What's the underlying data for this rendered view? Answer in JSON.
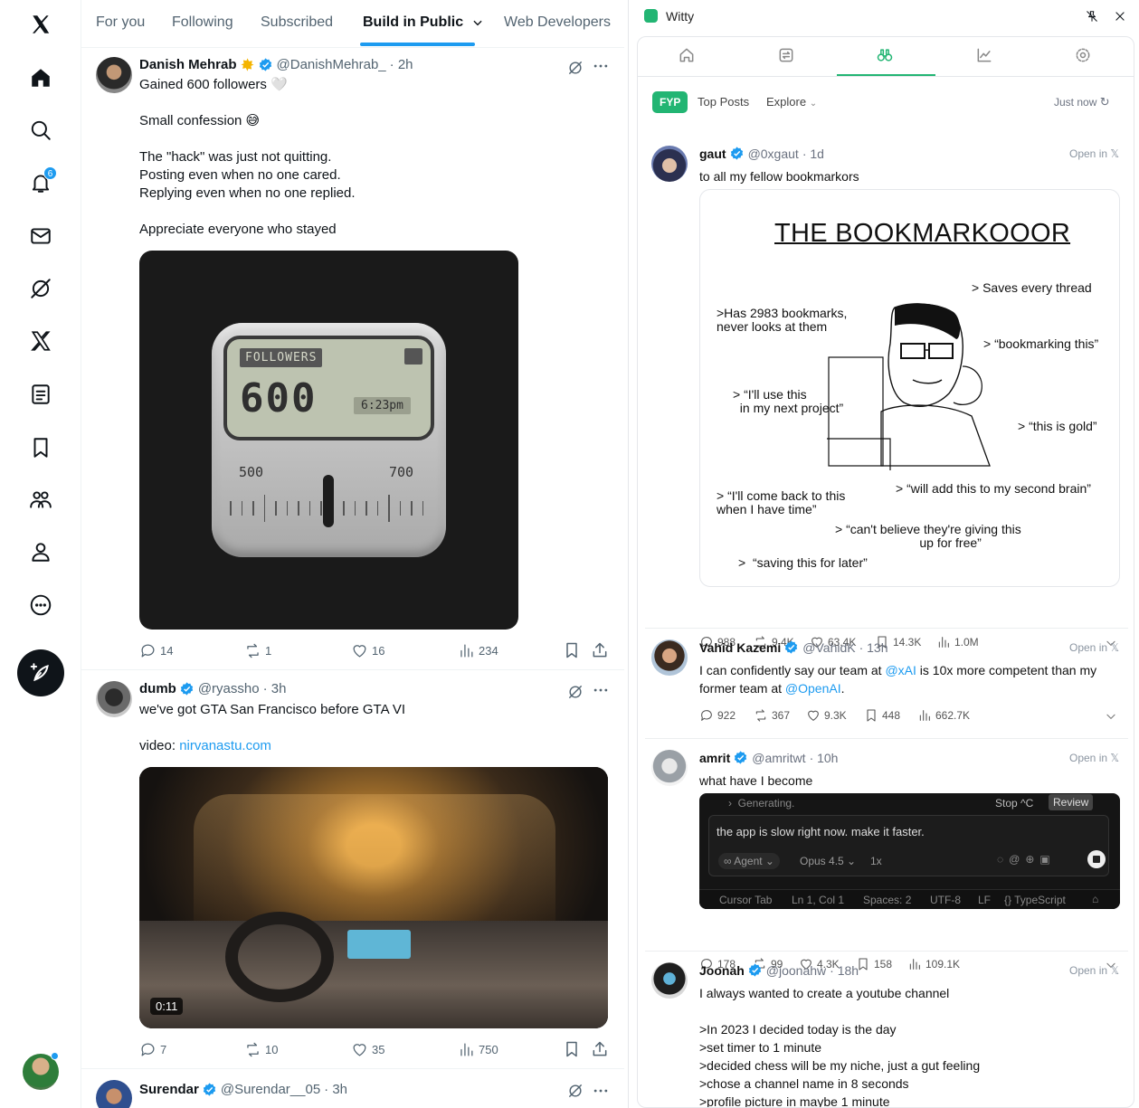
{
  "x_nav": {
    "notifications_badge": "6",
    "items": [
      "x-logo-icon",
      "home-icon",
      "search-icon",
      "bell-icon",
      "mail-icon",
      "grok-icon",
      "x-premium-icon",
      "lists-icon",
      "bookmark-icon",
      "communities-icon",
      "profile-icon",
      "more-circle-icon"
    ]
  },
  "feed": {
    "tabs": [
      "For you",
      "Following",
      "Subscribed",
      "Build in Public",
      "Web Developers"
    ],
    "posts": [
      {
        "name": "Danish Mehrab",
        "handle": "@DanishMehrab_",
        "time": "· 2h",
        "text": "Gained 600 followers 🤍\n\nSmall confession 😅\n\nThe \"hack\" was just not quitting.\nPosting even when no one cared.\nReplying even when no one replied.\n\nAppreciate everyone who stayed",
        "image": {
          "label": "FOLLOWERS",
          "value": "600",
          "time": "6:23pm",
          "scale_left": "500",
          "scale_right": "700"
        },
        "replies": "14",
        "reposts": "1",
        "likes": "16",
        "views": "234"
      },
      {
        "name": "dumb",
        "handle": "@ryassho",
        "time": "· 3h",
        "text_line1": "we've got GTA San Francisco before GTA VI",
        "text_video_label": "video: ",
        "text_link": "nirvanastu.com",
        "video_duration": "0:11",
        "replies": "7",
        "reposts": "10",
        "likes": "35",
        "views": "750"
      },
      {
        "name": "Surendar",
        "handle": "@Surendar__05",
        "time": "· 3h"
      }
    ]
  },
  "witty": {
    "title": "Witty",
    "tabs": [
      "home-icon",
      "repost-icon",
      "binoculars-icon",
      "chart-icon",
      "settings-icon"
    ],
    "filters": {
      "fyp": "FYP",
      "top": "Top Posts",
      "explore": "Explore"
    },
    "refresh": "Just now",
    "open_in": "Open in 𝕏",
    "posts": [
      {
        "name": "gaut",
        "handle": "@0xgaut",
        "time": "· 1d",
        "text": "to all my fellow bookmarkors",
        "meme": {
          "title": "THE BOOKMARKOOOR",
          "labels": [
            "> Saves every thread",
            ">Has 2983 bookmarks,\nnever looks at them",
            "> “bookmarking this”",
            "> “I'll use this\n  in my next project”",
            "> “this is gold”",
            "> “will add this to my second brain”",
            "> “I'll come back to this\nwhen I have time”",
            "> “can't believe they're giving this\n                        up for free”",
            ">  “saving this for later”"
          ]
        },
        "replies": "988",
        "reposts": "9.4K",
        "likes": "63.4K",
        "bookmarks": "14.3K",
        "views": "1.0M"
      },
      {
        "name": "Vahid Kazemi",
        "handle": "@VahidK",
        "time": "· 13h",
        "text_a": "I can confidently say our team at ",
        "mention_a": "@xAI",
        "text_b": " is 10x more competent than my",
        "text_c": "former team at ",
        "mention_b": "@OpenAI",
        "text_d": ".",
        "replies": "922",
        "reposts": "367",
        "likes": "9.3K",
        "bookmarks": "448",
        "views": "662.7K"
      },
      {
        "name": "amrit",
        "handle": "@amritwt",
        "time": "· 10h",
        "text": "what have I become",
        "screenshot": {
          "generating": "Generating.",
          "stop": "Stop ^C",
          "review": "Review",
          "prompt": "the app is slow right now. make it faster.",
          "agent": "∞ Agent ⌄",
          "model": "Opus 4.5 ⌄",
          "mult": "1x",
          "status": [
            "Cursor Tab",
            "Ln 1, Col 1",
            "Spaces: 2",
            "UTF-8",
            "LF",
            "{} TypeScript"
          ]
        },
        "replies": "178",
        "reposts": "99",
        "likes": "4.3K",
        "bookmarks": "158",
        "views": "109.1K"
      },
      {
        "name": "Joonah",
        "handle": "@joonahw",
        "time": "· 18h",
        "text": "I always wanted to create a youtube channel\n\n>In 2023 I decided today is the day\n>set timer to 1 minute\n>decided chess will be my niche, just a gut feeling\n>chose a channel name in 8 seconds\n>profile picture in maybe 1 minute"
      }
    ]
  },
  "colors": {
    "x_blue": "#1d9bf0",
    "witty_green": "#22b573",
    "text": "#0f1419",
    "muted": "#536471"
  }
}
